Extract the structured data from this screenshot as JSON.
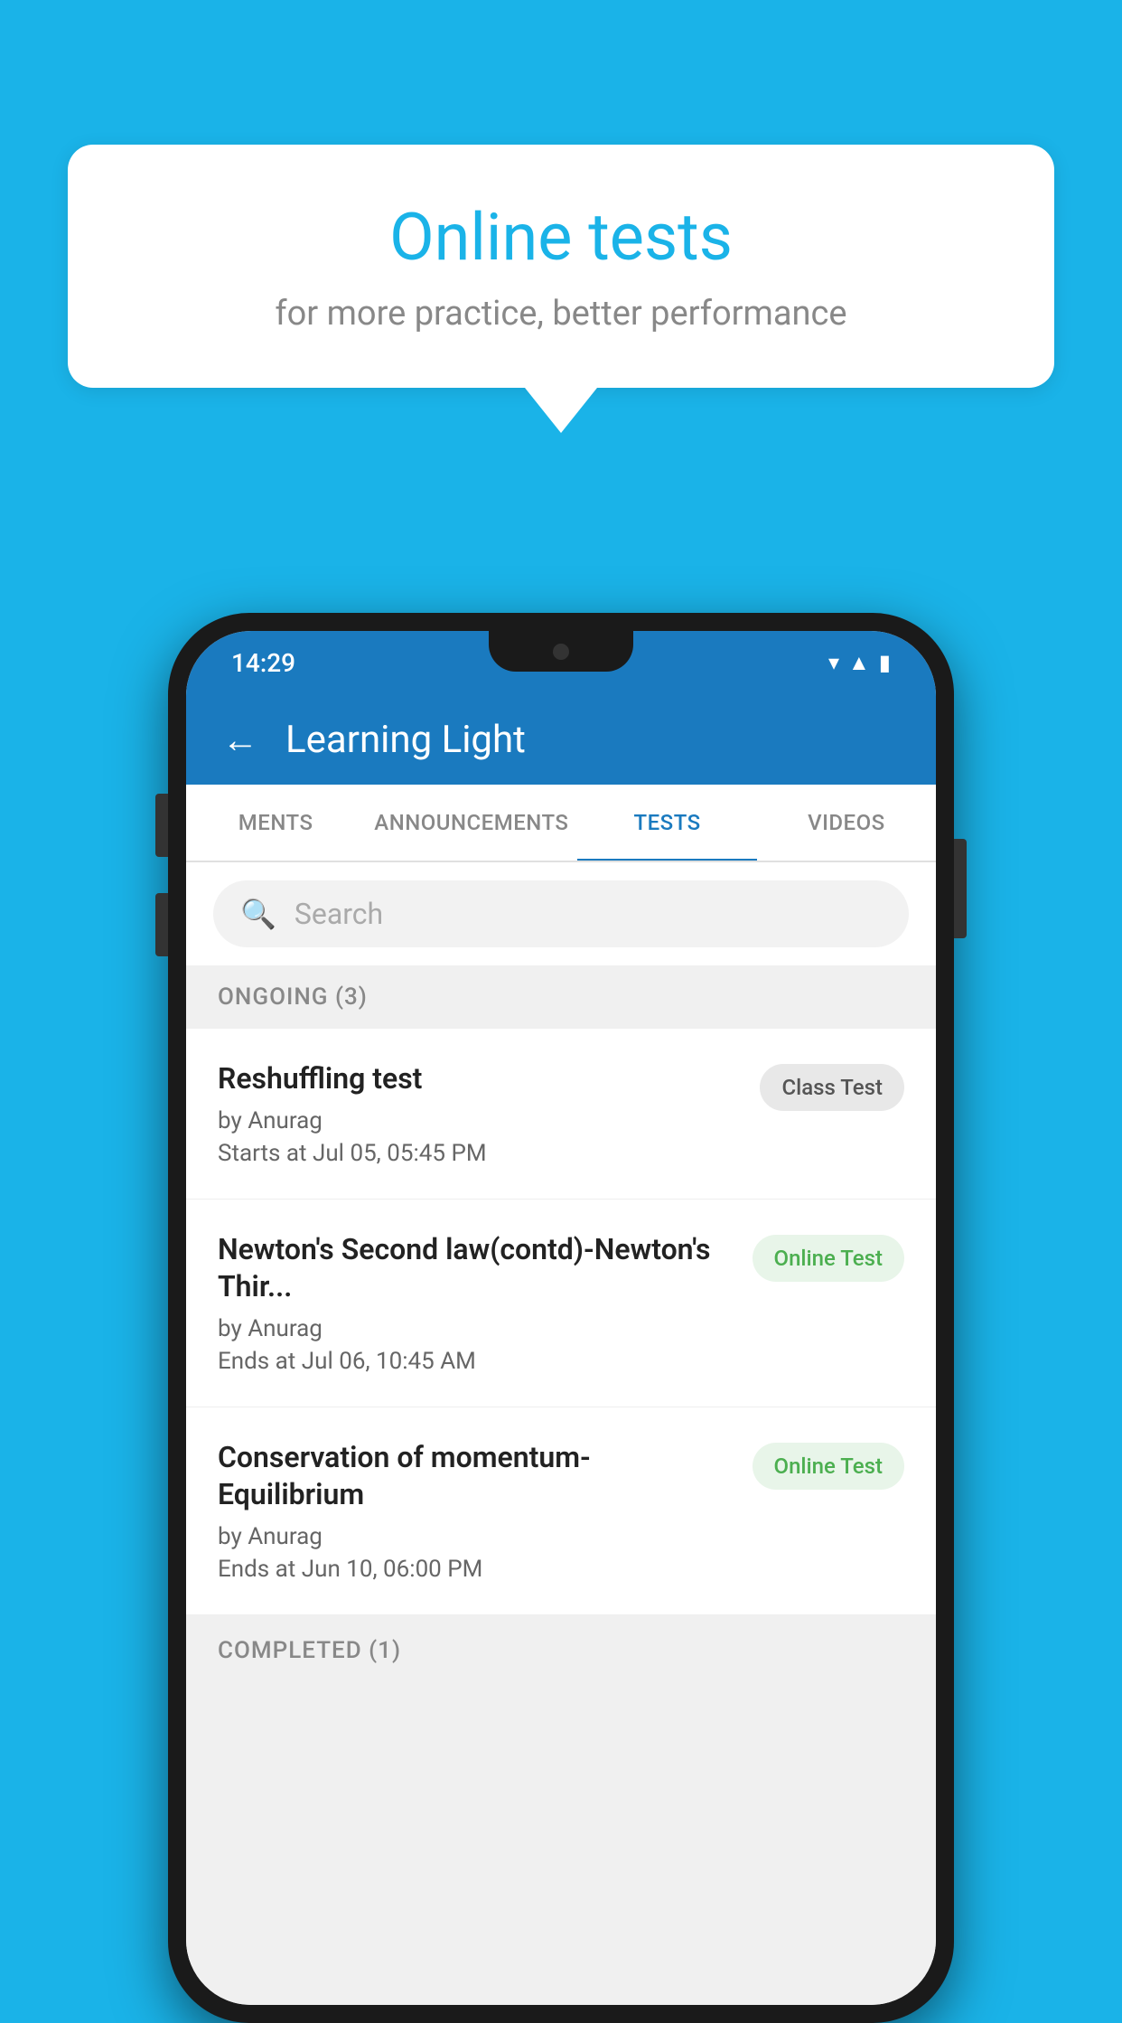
{
  "background": {
    "color": "#1ab3e8"
  },
  "speech_bubble": {
    "title": "Online tests",
    "subtitle": "for more practice, better performance"
  },
  "phone": {
    "status_bar": {
      "time": "14:29",
      "icons": [
        "wifi",
        "signal",
        "battery"
      ]
    },
    "app_bar": {
      "title": "Learning Light",
      "back_label": "←"
    },
    "tabs": [
      {
        "label": "MENTS",
        "active": false
      },
      {
        "label": "ANNOUNCEMENTS",
        "active": false
      },
      {
        "label": "TESTS",
        "active": true
      },
      {
        "label": "VIDEOS",
        "active": false
      }
    ],
    "search": {
      "placeholder": "Search"
    },
    "section_ongoing": {
      "label": "ONGOING (3)"
    },
    "tests": [
      {
        "title": "Reshuffling test",
        "author": "by Anurag",
        "date": "Starts at  Jul 05, 05:45 PM",
        "badge": "Class Test",
        "badge_type": "class"
      },
      {
        "title": "Newton's Second law(contd)-Newton's Thir...",
        "author": "by Anurag",
        "date": "Ends at  Jul 06, 10:45 AM",
        "badge": "Online Test",
        "badge_type": "online"
      },
      {
        "title": "Conservation of momentum-Equilibrium",
        "author": "by Anurag",
        "date": "Ends at  Jun 10, 06:00 PM",
        "badge": "Online Test",
        "badge_type": "online"
      }
    ],
    "section_completed": {
      "label": "COMPLETED (1)"
    }
  }
}
